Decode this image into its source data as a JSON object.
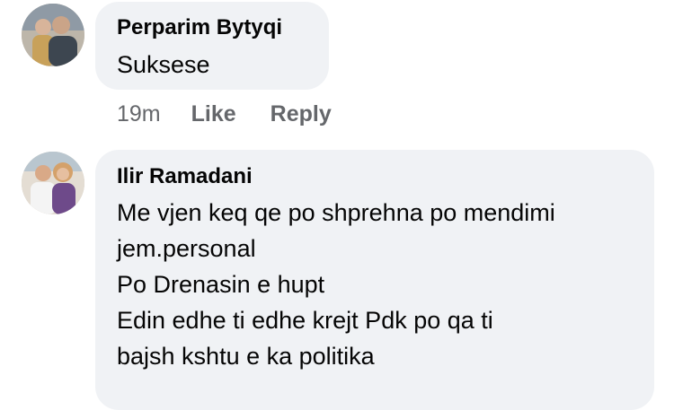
{
  "comments": [
    {
      "author": "Perparim Bytyqi",
      "lines": [
        "Suksese"
      ],
      "time": "19m",
      "like_label": "Like",
      "reply_label": "Reply"
    },
    {
      "author": "Ilir Ramadani",
      "lines": [
        "Me vjen keq qe po shprehna po mendimi",
        "jem.personal",
        "Po Drenasin e hupt",
        "Edin edhe ti edhe krejt Pdk  po  qa  ti",
        "bajsh kshtu e ka politika"
      ]
    }
  ],
  "colors": {
    "bubble": "#f0f2f5",
    "secondary_text": "#65676b",
    "primary_text": "#050505"
  }
}
